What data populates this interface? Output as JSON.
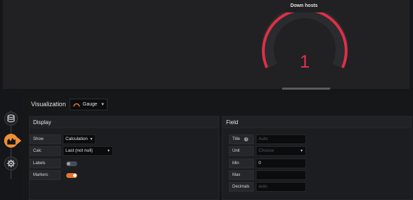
{
  "preview": {
    "panel_title": "Down hosts",
    "gauge": {
      "value": "1",
      "value_color": "#e02f44",
      "arc_color": "#e02f44"
    }
  },
  "sidebar": {
    "items": [
      {
        "name": "queries",
        "icon": "database-icon",
        "active": false
      },
      {
        "name": "visualization",
        "icon": "chart-icon",
        "active": true
      },
      {
        "name": "general",
        "icon": "gear-icon",
        "active": false
      }
    ],
    "accent": "#f08f35"
  },
  "visualization": {
    "label": "Visualization",
    "picker": {
      "icon": "gauge-icon",
      "value": "Gauge"
    }
  },
  "display": {
    "title": "Display",
    "show": {
      "label": "Show",
      "value": "Calculation"
    },
    "calc": {
      "label": "Calc",
      "value": "Last (not null)"
    },
    "labels": {
      "label": "Labels",
      "enabled": false
    },
    "markers": {
      "label": "Markers",
      "enabled": true
    }
  },
  "field": {
    "title": "Field",
    "title_field": {
      "label": "Title",
      "placeholder": "Auto"
    },
    "unit": {
      "label": "Unit",
      "placeholder": "Choose"
    },
    "min": {
      "label": "Min",
      "value": "0"
    },
    "max": {
      "label": "Max",
      "value": ""
    },
    "decimals": {
      "label": "Decimals",
      "placeholder": "auto"
    }
  }
}
